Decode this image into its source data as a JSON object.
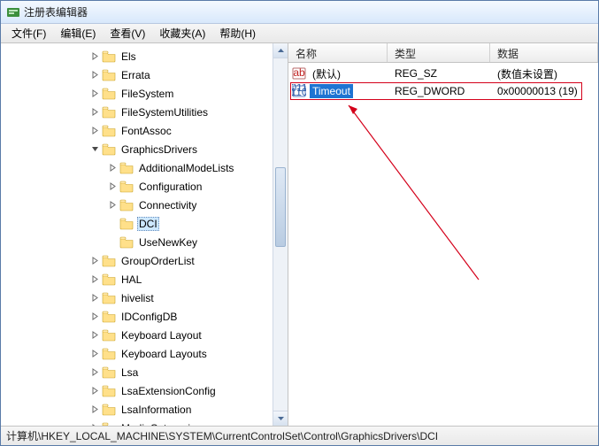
{
  "window": {
    "title": "注册表编辑器"
  },
  "menu": {
    "file": "文件(F)",
    "edit": "编辑(E)",
    "view": "查看(V)",
    "fav": "收藏夹(A)",
    "help": "帮助(H)"
  },
  "tree": [
    {
      "indent": 100,
      "exp": "closed",
      "label": "Els"
    },
    {
      "indent": 100,
      "exp": "closed",
      "label": "Errata"
    },
    {
      "indent": 100,
      "exp": "closed",
      "label": "FileSystem"
    },
    {
      "indent": 100,
      "exp": "closed",
      "label": "FileSystemUtilities"
    },
    {
      "indent": 100,
      "exp": "closed",
      "label": "FontAssoc"
    },
    {
      "indent": 100,
      "exp": "open",
      "label": "GraphicsDrivers"
    },
    {
      "indent": 120,
      "exp": "closed",
      "label": "AdditionalModeLists"
    },
    {
      "indent": 120,
      "exp": "closed",
      "label": "Configuration"
    },
    {
      "indent": 120,
      "exp": "closed",
      "label": "Connectivity"
    },
    {
      "indent": 120,
      "exp": "none",
      "label": "DCI",
      "selected": true
    },
    {
      "indent": 120,
      "exp": "none",
      "label": "UseNewKey"
    },
    {
      "indent": 100,
      "exp": "closed",
      "label": "GroupOrderList"
    },
    {
      "indent": 100,
      "exp": "closed",
      "label": "HAL"
    },
    {
      "indent": 100,
      "exp": "closed",
      "label": "hivelist"
    },
    {
      "indent": 100,
      "exp": "closed",
      "label": "IDConfigDB"
    },
    {
      "indent": 100,
      "exp": "closed",
      "label": "Keyboard Layout"
    },
    {
      "indent": 100,
      "exp": "closed",
      "label": "Keyboard Layouts"
    },
    {
      "indent": 100,
      "exp": "closed",
      "label": "Lsa"
    },
    {
      "indent": 100,
      "exp": "closed",
      "label": "LsaExtensionConfig"
    },
    {
      "indent": 100,
      "exp": "closed",
      "label": "LsaInformation"
    },
    {
      "indent": 100,
      "exp": "closed",
      "label": "MediaCategories"
    }
  ],
  "columns": {
    "name": "名称",
    "type": "类型",
    "data": "数据"
  },
  "values": [
    {
      "icon": "ab",
      "name": "(默认)",
      "type": "REG_SZ",
      "data": "(数值未设置)"
    },
    {
      "icon": "bin",
      "name": "Timeout",
      "type": "REG_DWORD",
      "data": "0x00000013 (19)",
      "selected": true
    }
  ],
  "status": "计算机\\HKEY_LOCAL_MACHINE\\SYSTEM\\CurrentControlSet\\Control\\GraphicsDrivers\\DCI"
}
